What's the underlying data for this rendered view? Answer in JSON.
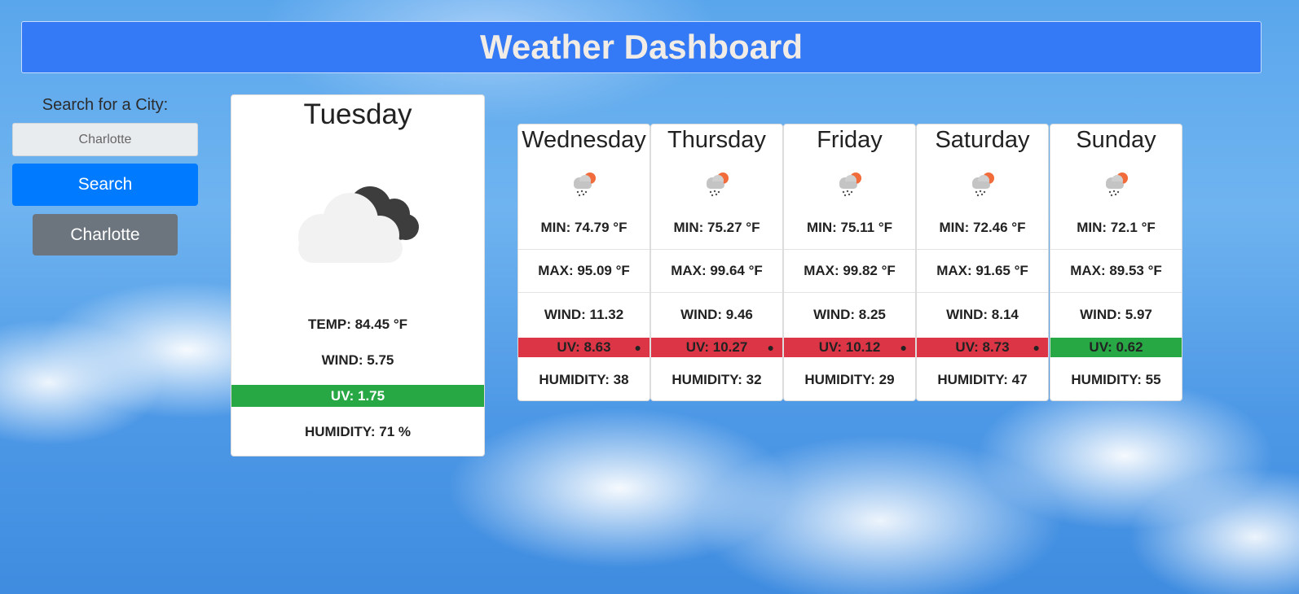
{
  "header": {
    "title": "Weather Dashboard"
  },
  "search": {
    "label": "Search for a City:",
    "input_value": "Charlotte",
    "button_label": "Search"
  },
  "history": [
    {
      "label": "Charlotte"
    }
  ],
  "colors": {
    "header": "#3479f5",
    "uv_high": "#dc3545",
    "uv_low": "#28a745",
    "search_button": "#007bff",
    "history_button": "#6c757d"
  },
  "today": {
    "day": "Tuesday",
    "icon": "cloudy-icon",
    "temp": "TEMP: 84.45 °F",
    "wind": "WIND: 5.75",
    "uv": "UV: 1.75",
    "uv_level": "low",
    "humidity": "HUMIDITY: 71 %"
  },
  "forecast": [
    {
      "day": "Wednesday",
      "icon": "rain-icon",
      "min": "MIN: 74.79 °F",
      "max": "MAX: 95.09 °F",
      "wind": "WIND: 11.32",
      "uv": "UV: 8.63",
      "uv_level": "high",
      "humidity": "HUMIDITY: 38"
    },
    {
      "day": "Thursday",
      "icon": "rain-icon",
      "min": "MIN: 75.27 °F",
      "max": "MAX: 99.64 °F",
      "wind": "WIND: 9.46",
      "uv": "UV: 10.27",
      "uv_level": "high",
      "humidity": "HUMIDITY: 32"
    },
    {
      "day": "Friday",
      "icon": "rain-icon",
      "min": "MIN: 75.11 °F",
      "max": "MAX: 99.82 °F",
      "wind": "WIND: 8.25",
      "uv": "UV: 10.12",
      "uv_level": "high",
      "humidity": "HUMIDITY: 29"
    },
    {
      "day": "Saturday",
      "icon": "rain-icon",
      "min": "MIN: 72.46 °F",
      "max": "MAX: 91.65 °F",
      "wind": "WIND: 8.14",
      "uv": "UV: 8.73",
      "uv_level": "high",
      "humidity": "HUMIDITY: 47"
    },
    {
      "day": "Sunday",
      "icon": "rain-icon",
      "min": "MIN: 72.1 °F",
      "max": "MAX: 89.53 °F",
      "wind": "WIND: 5.97",
      "uv": "UV: 0.62",
      "uv_level": "low",
      "humidity": "HUMIDITY: 55"
    }
  ]
}
